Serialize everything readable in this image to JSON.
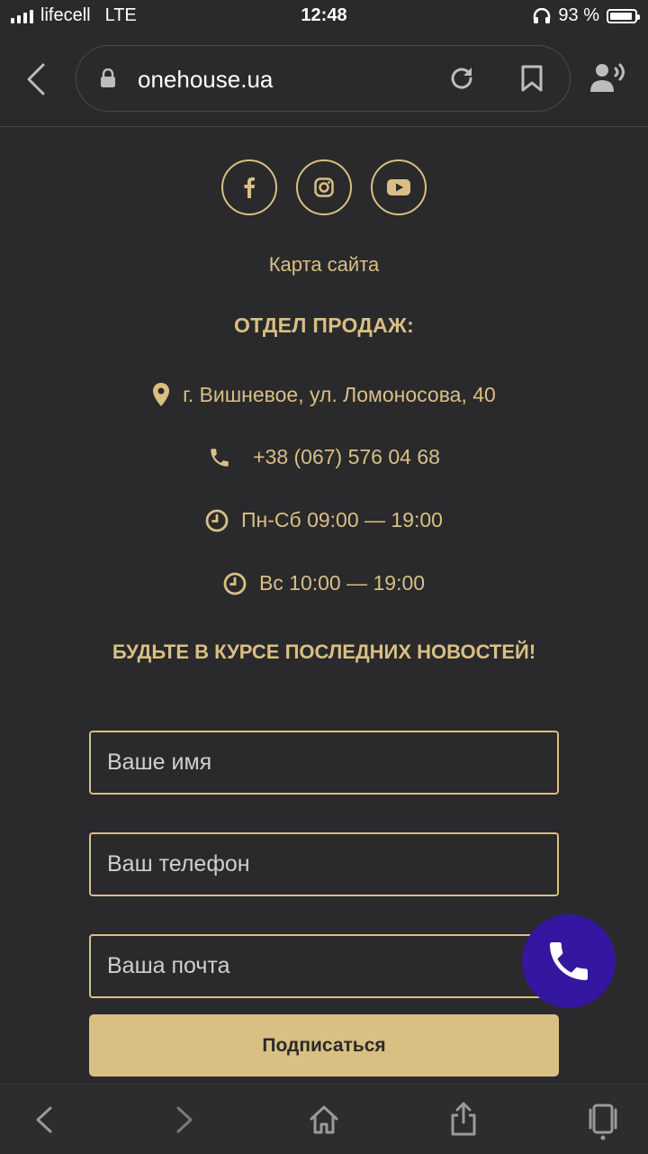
{
  "status_bar": {
    "carrier": "lifecell",
    "network": "LTE",
    "time": "12:48",
    "battery": "93 %",
    "battery_level": 0.93
  },
  "browser": {
    "url": "onehouse.ua",
    "icons": [
      "back-icon",
      "lock-icon",
      "reload-icon",
      "bookmark-icon",
      "reader-icon"
    ]
  },
  "social": {
    "icons": [
      "facebook-icon",
      "instagram-icon",
      "youtube-icon"
    ]
  },
  "footer": {
    "sitemap_link": "Карта сайта",
    "sales_title": "ОТДЕЛ ПРОДАЖ:",
    "address": "г. Вишневое, ул. Ломоносова, 40",
    "phone": "+38 (067) 576 04 68",
    "hours_weekdays": "Пн-Сб 09:00 — 19:00",
    "hours_sunday": "Вс 10:00 — 19:00"
  },
  "newsletter": {
    "title": "БУДЬТЕ В КУРСЕ ПОСЛЕДНИХ НОВОСТЕЙ!",
    "name_placeholder": "Ваше имя",
    "phone_placeholder": "Ваш телефон",
    "email_placeholder": "Ваша почта",
    "submit_label": "Подписаться"
  },
  "colors": {
    "background": "#2a2a2c",
    "accent": "#d9bf83",
    "call_button": "#3516a0"
  }
}
